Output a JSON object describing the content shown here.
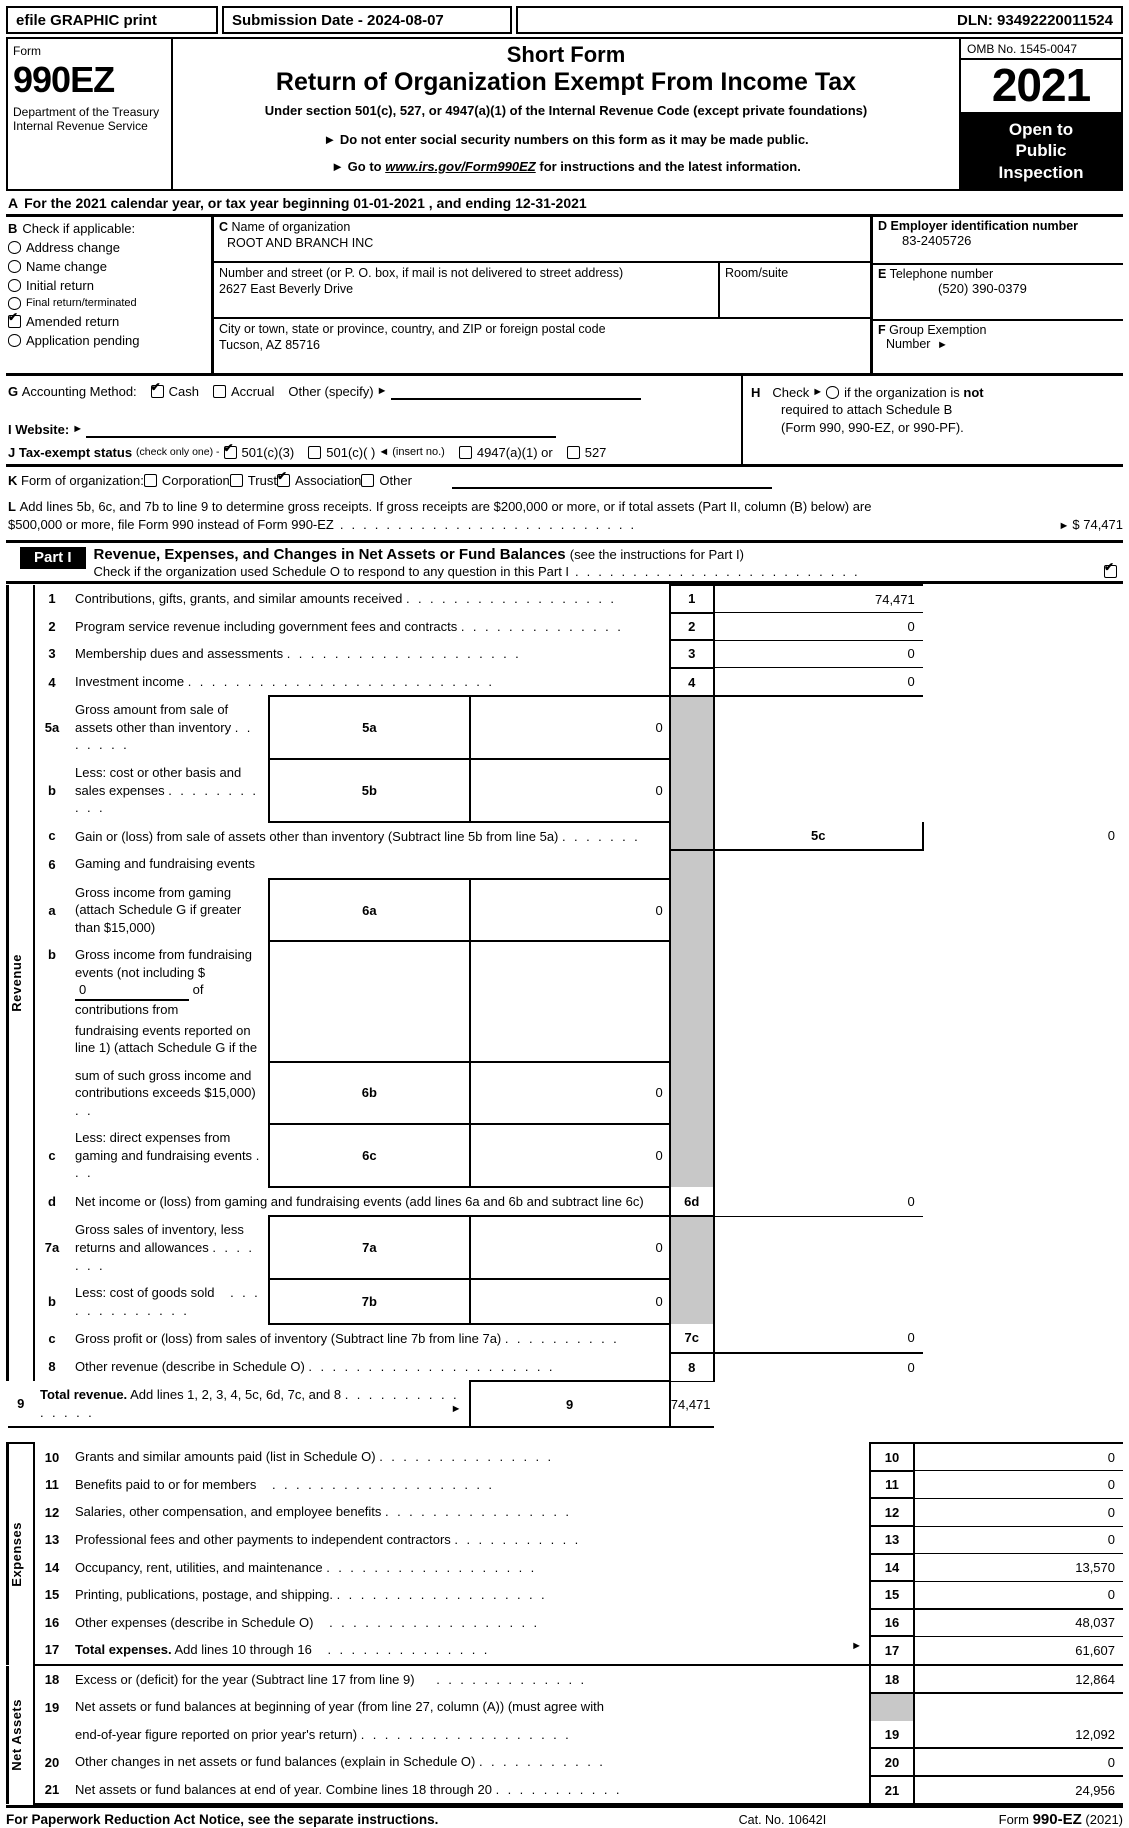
{
  "efile": {
    "graphic_label": "efile GRAPHIC print",
    "submission_date": "Submission Date - 2024-08-07",
    "dln": "DLN: 93492220011524"
  },
  "masthead": {
    "form_label": "Form",
    "form_number": "990EZ",
    "department": "Department of the Treasury",
    "irs": "Internal Revenue Service",
    "title_short": "Short Form",
    "title_main": "Return of Organization Exempt From Income Tax",
    "subtitle": "Under section 501(c), 527, or 4947(a)(1) of the Internal Revenue Code (except private foundations)",
    "bullet1": "Do not enter social security numbers on this form as it may be made public.",
    "bullet2_pre": "Go to",
    "bullet2_link": "www.irs.gov/Form990EZ",
    "bullet2_post": "for instructions and the latest information.",
    "omb": "OMB No. 1545-0047",
    "year": "2021",
    "open_to": "Open to",
    "public": "Public",
    "inspection": "Inspection"
  },
  "line_a": {
    "letter": "A",
    "text": "For the 2021 calendar year, or tax year beginning 01-01-2021 , and ending 12-31-2021"
  },
  "box_b": {
    "letter": "B",
    "heading": "Check if applicable:",
    "options": [
      {
        "label": "Address change",
        "checked": false,
        "small": false
      },
      {
        "label": "Name change",
        "checked": false,
        "small": false
      },
      {
        "label": "Initial return",
        "checked": false,
        "small": false
      },
      {
        "label": "Final return/terminated",
        "checked": false,
        "small": true
      },
      {
        "label": "Amended return",
        "checked": true,
        "small": false
      },
      {
        "label": "Application pending",
        "checked": false,
        "small": false
      }
    ]
  },
  "box_c": {
    "letter": "C",
    "name_caption": "Name of organization",
    "name_value": "ROOT AND BRANCH INC",
    "street_caption": "Number and street (or P. O. box, if mail is not delivered to street address)",
    "street_value": "2627 East Beverly Drive",
    "room_caption": "Room/suite",
    "room_value": "",
    "city_caption": "City or town, state or province, country, and ZIP or foreign postal code",
    "city_value": "Tucson, AZ   85716"
  },
  "box_d": {
    "letter": "D",
    "ein_caption": "Employer identification number",
    "ein_value": "83-2405726",
    "letter_e": "E",
    "phone_caption": "Telephone number",
    "phone_value": "(520) 390-0379",
    "letter_f": "F",
    "group_caption_1": "Group Exemption",
    "group_caption_2": "Number",
    "group_value": ""
  },
  "box_g": {
    "letter": "G",
    "label": "Accounting Method:",
    "cash": "Cash",
    "cash_checked": true,
    "accrual": "Accrual",
    "accrual_checked": false,
    "other": "Other (specify)"
  },
  "box_h": {
    "letter": "H",
    "check_label": "Check",
    "text1_a": "if the organization is",
    "text1_b": "not",
    "text2": "required to attach Schedule B",
    "text3": "(Form 990, 990-EZ, or 990-PF)."
  },
  "box_i": {
    "letter": "I",
    "label": "Website:",
    "value": ""
  },
  "box_j": {
    "letter": "J",
    "label": "Tax-exempt status",
    "note": "(check only one) -",
    "opt1": "501(c)(3)",
    "opt1_checked": true,
    "opt2": "501(c)(    )",
    "opt2_checked": false,
    "insert": "(insert no.)",
    "opt3": "4947(a)(1) or",
    "opt3_checked": false,
    "opt4": "527",
    "opt4_checked": false
  },
  "box_k": {
    "letter": "K",
    "label": "Form of organization:",
    "options": [
      {
        "label": "Corporation",
        "checked": false
      },
      {
        "label": "Trust",
        "checked": false
      },
      {
        "label": "Association",
        "checked": true
      },
      {
        "label": "Other",
        "checked": false
      }
    ]
  },
  "box_l": {
    "letter": "L",
    "text1": "Add lines 5b, 6c, and 7b to line 9 to determine gross receipts. If gross receipts are $200,000 or more, or if total assets (Part II, column (B) below) are",
    "text2": "$500,000 or more, file Form 990 instead of Form 990-EZ",
    "amount": "$ 74,471"
  },
  "part1": {
    "tab": "Part I",
    "title": "Revenue, Expenses, and Changes in Net Assets or Fund Balances",
    "title_note": "(see the instructions for Part I)",
    "schedule_o_text": "Check if the organization used Schedule O to respond to any question in this Part I",
    "schedule_o_checked": true
  },
  "sections": {
    "revenue_label": "Revenue",
    "expenses_label": "Expenses",
    "net_assets_label": "Net Assets"
  },
  "revenue_rows": [
    {
      "num": "1",
      "desc": "Contributions, gifts, grants, and similar amounts received",
      "box": "1",
      "value": "74,471"
    },
    {
      "num": "2",
      "desc": "Program service revenue including government fees and contracts",
      "box": "2",
      "value": "0"
    },
    {
      "num": "3",
      "desc": "Membership dues and assessments",
      "box": "3",
      "value": "0"
    },
    {
      "num": "4",
      "desc": "Investment income",
      "box": "4",
      "value": "0"
    },
    {
      "num": "5a",
      "desc": "Gross amount from sale of assets other than inventory",
      "subbox": "5a",
      "subvalue": "0"
    },
    {
      "num": "b",
      "desc": "Less: cost or other basis and sales expenses",
      "subbox": "5b",
      "subvalue": "0"
    },
    {
      "num": "c",
      "desc": "Gain or (loss) from sale of assets other than inventory (Subtract line 5b from line 5a)",
      "box": "5c",
      "value": "0"
    },
    {
      "num": "6",
      "desc": "Gaming and fundraising events"
    },
    {
      "num": "a",
      "desc": "Gross income from gaming (attach Schedule G if greater than $15,000)",
      "subbox": "6a",
      "subvalue": "0"
    },
    {
      "num": "b",
      "desc_1": "Gross income from fundraising events (not including $",
      "inline_value": "0",
      "desc_2": "of contributions from",
      "desc_3": "fundraising events reported on line 1) (attach Schedule G if the",
      "desc_4": "sum of such gross income and contributions exceeds $15,000)",
      "subbox": "6b",
      "subvalue": "0"
    },
    {
      "num": "c",
      "desc": "Less: direct expenses from gaming and fundraising events",
      "subbox": "6c",
      "subvalue": "0"
    },
    {
      "num": "d",
      "desc": "Net income or (loss) from gaming and fundraising events (add lines 6a and 6b and subtract line 6c)",
      "box": "6d",
      "value": "0"
    },
    {
      "num": "7a",
      "desc": "Gross sales of inventory, less returns and allowances",
      "subbox": "7a",
      "subvalue": "0"
    },
    {
      "num": "b",
      "desc": "Less: cost of goods sold",
      "subbox": "7b",
      "subvalue": "0"
    },
    {
      "num": "c",
      "desc": "Gross profit or (loss) from sales of inventory (Subtract line 7b from line 7a)",
      "box": "7c",
      "value": "0"
    },
    {
      "num": "8",
      "desc": "Other revenue (describe in Schedule O)",
      "box": "8",
      "value": "0"
    },
    {
      "num": "9",
      "desc_bold": "Total revenue.",
      "desc": "Add lines 1, 2, 3, 4, 5c, 6d, 7c, and 8",
      "box": "9",
      "value": "74,471"
    }
  ],
  "expense_rows": [
    {
      "num": "10",
      "desc": "Grants and similar amounts paid (list in Schedule O)",
      "box": "10",
      "value": "0"
    },
    {
      "num": "11",
      "desc": "Benefits paid to or for members",
      "box": "11",
      "value": "0"
    },
    {
      "num": "12",
      "desc": "Salaries, other compensation, and employee benefits",
      "box": "12",
      "value": "0"
    },
    {
      "num": "13",
      "desc": "Professional fees and other payments to independent contractors",
      "box": "13",
      "value": "0"
    },
    {
      "num": "14",
      "desc": "Occupancy, rent, utilities, and maintenance",
      "box": "14",
      "value": "13,570"
    },
    {
      "num": "15",
      "desc": "Printing, publications, postage, and shipping.",
      "box": "15",
      "value": "0"
    },
    {
      "num": "16",
      "desc": "Other expenses (describe in Schedule O)",
      "box": "16",
      "value": "48,037"
    },
    {
      "num": "17",
      "desc_bold": "Total expenses.",
      "desc": "Add lines 10 through 16",
      "box": "17",
      "value": "61,607"
    }
  ],
  "netasset_rows": [
    {
      "num": "18",
      "desc": "Excess or (deficit) for the year (Subtract line 17 from line 9)",
      "box": "18",
      "value": "12,864"
    },
    {
      "num": "19",
      "desc_1": "Net assets or fund balances at beginning of year (from line 27, column (A)) (must agree with",
      "desc_2": "end-of-year figure reported on prior year's return)",
      "box": "19",
      "value": "12,092"
    },
    {
      "num": "20",
      "desc": "Other changes in net assets or fund balances (explain in Schedule O)",
      "box": "20",
      "value": "0"
    },
    {
      "num": "21",
      "desc": "Net assets or fund balances at end of year. Combine lines 18 through 20",
      "box": "21",
      "value": "24,956"
    }
  ],
  "footer": {
    "left": "For Paperwork Reduction Act Notice, see the separate instructions.",
    "center": "Cat. No. 10642I",
    "right_pre": "Form",
    "right_bold": "990-EZ",
    "right_post": "(2021)"
  },
  "colors": {
    "ink": "#000000",
    "shade": "#c8c8c8",
    "paper": "#ffffff"
  }
}
